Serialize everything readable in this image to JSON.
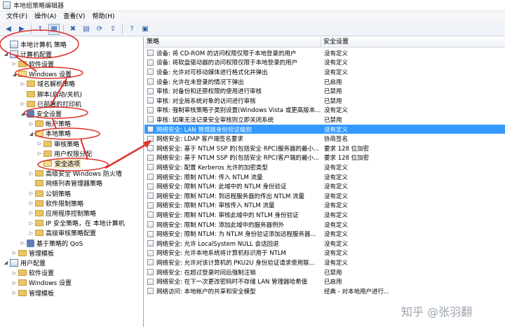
{
  "window": {
    "title": "本地组策略编辑器"
  },
  "menu": [
    "文件(F)",
    "操作(A)",
    "查看(V)",
    "帮助(H)"
  ],
  "toolbar": {
    "icons": [
      "back-arrow",
      "forward-arrow",
      "up-folder",
      "show-hide-tree",
      "delete",
      "properties",
      "refresh",
      "export",
      "help",
      "filter"
    ],
    "glyphs": [
      "◀",
      "▶",
      "⮤",
      "▦",
      "✖",
      "▤",
      "⟳",
      "⇪",
      "?",
      "▣"
    ]
  },
  "tree": [
    {
      "label": "本地计算机 策略",
      "level": 0,
      "toggle": "",
      "icon": "policy"
    },
    {
      "label": "计算机配置",
      "level": 0,
      "toggle": "◢",
      "icon": "computer"
    },
    {
      "label": "软件设置",
      "level": 1,
      "toggle": "▷",
      "icon": "folder"
    },
    {
      "label": "Windows 设置",
      "level": 1,
      "toggle": "◢",
      "icon": "folder-open"
    },
    {
      "label": "域名解析策略",
      "level": 2,
      "toggle": "▷",
      "icon": "folder"
    },
    {
      "label": "脚本(启动/关机)",
      "level": 2,
      "toggle": "",
      "icon": "folder"
    },
    {
      "label": "已部署的打印机",
      "level": 2,
      "toggle": "▷",
      "icon": "folder"
    },
    {
      "label": "安全设置",
      "level": 2,
      "toggle": "◢",
      "icon": "security"
    },
    {
      "label": "帐户策略",
      "level": 3,
      "toggle": "▷",
      "icon": "folder"
    },
    {
      "label": "本地策略",
      "level": 3,
      "toggle": "◢",
      "icon": "folder-open"
    },
    {
      "label": "审核策略",
      "level": 4,
      "toggle": "▷",
      "icon": "folder"
    },
    {
      "label": "用户权限分配",
      "level": 4,
      "toggle": "▷",
      "icon": "folder"
    },
    {
      "label": "安全选项",
      "level": 4,
      "toggle": "",
      "icon": "folder-open",
      "selected": true
    },
    {
      "label": "高级安全 Windows 防火墙",
      "level": 3,
      "toggle": "▷",
      "icon": "folder"
    },
    {
      "label": "网络列表管理器策略",
      "level": 3,
      "toggle": "",
      "icon": "folder"
    },
    {
      "label": "公钥策略",
      "level": 3,
      "toggle": "▷",
      "icon": "folder"
    },
    {
      "label": "软件限制策略",
      "level": 3,
      "toggle": "▷",
      "icon": "folder"
    },
    {
      "label": "应用程序控制策略",
      "level": 3,
      "toggle": "▷",
      "icon": "folder"
    },
    {
      "label": "IP 安全策略，在 本地计算机",
      "level": 3,
      "toggle": "▷",
      "icon": "folder"
    },
    {
      "label": "高级审核策略配置",
      "level": 3,
      "toggle": "▷",
      "icon": "folder"
    },
    {
      "label": "基于策略的 QoS",
      "level": 2,
      "toggle": "▷",
      "icon": "chart"
    },
    {
      "label": "管理模板",
      "level": 1,
      "toggle": "▷",
      "icon": "folder"
    },
    {
      "label": "用户配置",
      "level": 0,
      "toggle": "◢",
      "icon": "user"
    },
    {
      "label": "软件设置",
      "level": 1,
      "toggle": "▷",
      "icon": "folder"
    },
    {
      "label": "Windows 设置",
      "level": 1,
      "toggle": "▷",
      "icon": "folder"
    },
    {
      "label": "管理模板",
      "level": 1,
      "toggle": "▷",
      "icon": "folder"
    }
  ],
  "list": {
    "columns": [
      "策略",
      "安全设置"
    ],
    "rows": [
      [
        "设备: 将 CD-ROM 的访问权限仅限于本地登录的用户",
        "没有定义"
      ],
      [
        "设备: 将软盘驱动器的访问权限仅限于本地登录的用户",
        "没有定义"
      ],
      [
        "设备: 允许对可移动媒体进行格式化并弹出",
        "没有定义"
      ],
      [
        "设备: 允许在未登录的情况下弹出",
        "已启用"
      ],
      [
        "审核: 对备份和还原权限的使用进行审核",
        "已禁用"
      ],
      [
        "审核: 对全局系统对象的访问进行审核",
        "已禁用"
      ],
      [
        "审核: 强制审核策略子类别设置(Windows Vista 或更高版本...",
        "没有定义"
      ],
      [
        "审核: 如果无法记录安全审核则立即关闭系统",
        "已禁用"
      ],
      [
        "网络安全: LAN 管理器身份验证级别",
        "没有定义"
      ],
      [
        "网络安全: LDAP 客户端签名要求",
        "协商签名"
      ],
      [
        "网络安全: 基于 NTLM SSP 的(包括安全 RPC)服务器的最小...",
        "要求 128 位加密"
      ],
      [
        "网络安全: 基于 NTLM SSP 的(包括安全 RPC)客户端的最小...",
        "要求 128 位加密"
      ],
      [
        "网络安全: 配置 Kerberos 允许的加密类型",
        "没有定义"
      ],
      [
        "网络安全: 限制 NTLM: 传入 NTLM 流量",
        "没有定义"
      ],
      [
        "网络安全: 限制 NTLM: 此域中的 NTLM 身份验证",
        "没有定义"
      ],
      [
        "网络安全: 限制 NTLM: 到远程服务器的传出 NTLM 流量",
        "没有定义"
      ],
      [
        "网络安全: 限制 NTLM: 审核传入 NTLM 流量",
        "没有定义"
      ],
      [
        "网络安全: 限制 NTLM: 审核此域中的 NTLM 身份验证",
        "没有定义"
      ],
      [
        "网络安全: 限制 NTLM: 添加此域中的服务器例外",
        "没有定义"
      ],
      [
        "网络安全: 限制 NTLM: 为 NTLM 身份验证添加远程服务器...",
        "没有定义"
      ],
      [
        "网络安全: 允许 LocalSystem NULL 会话回退",
        "没有定义"
      ],
      [
        "网络安全: 允许本地系统将计算机标识用于 NTLM",
        "没有定义"
      ],
      [
        "网络安全: 允许对该计算机的 PKU2U 身份验证请求使用联...",
        "没有定义"
      ],
      [
        "网络安全: 在超过登录时间后强制注销",
        "已禁用"
      ],
      [
        "网络安全: 在下一次更改密码时不存储 LAN 管理器哈希值",
        "已启用"
      ],
      [
        "网络访问: 本地帐户的共享和安全模型",
        "经典 - 对本地用户进行..."
      ]
    ],
    "selected_index": 8
  },
  "watermark": "知乎 @张羽翻",
  "colors": {
    "annotation": "#e0302a",
    "selection": "#3399ff"
  }
}
